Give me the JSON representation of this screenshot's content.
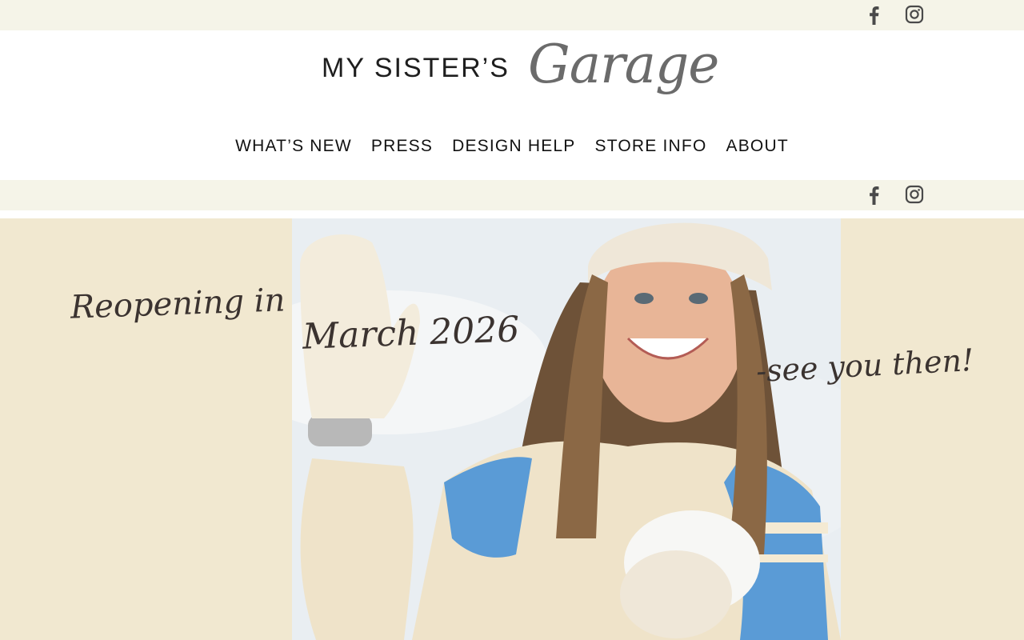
{
  "brand": {
    "name_caps": "MY SISTER’S",
    "name_script": "Garage"
  },
  "nav": {
    "items": [
      {
        "label": "WHAT’S NEW"
      },
      {
        "label": "PRESS"
      },
      {
        "label": "DESIGN HELP"
      },
      {
        "label": "STORE INFO"
      },
      {
        "label": "ABOUT"
      }
    ]
  },
  "social": {
    "icons": [
      "facebook-icon",
      "instagram-icon"
    ]
  },
  "hero": {
    "line1": "Reopening in",
    "line2": "March 2026",
    "line3": "-see you then!",
    "image": "woman-in-snow-photo"
  },
  "colors": {
    "topbar_bg": "#f5f4e8",
    "hero_bg": "#f1e8d0",
    "script_text": "#3b3330"
  }
}
